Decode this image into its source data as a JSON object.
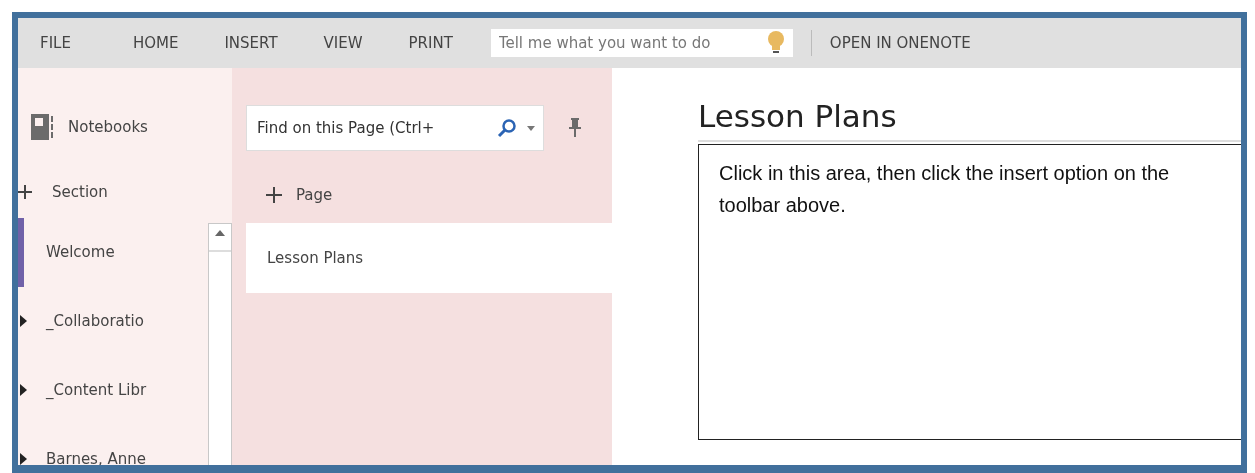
{
  "menu": [
    {
      "label": "FILE"
    },
    {
      "label": "HOME"
    },
    {
      "label": "INSERT"
    },
    {
      "label": "VIEW"
    },
    {
      "label": "PRINT"
    }
  ],
  "tell_me": {
    "placeholder": "Tell me what you want to do"
  },
  "open_button": "OPEN IN ONENOTE",
  "notebooks_label": "Notebooks",
  "add_section": "Section",
  "sections": [
    {
      "label": "Welcome",
      "selected": true,
      "expandable": false
    },
    {
      "label": "_Collaboratio",
      "selected": false,
      "expandable": true
    },
    {
      "label": "_Content Libr",
      "selected": false,
      "expandable": true
    },
    {
      "label": "Barnes, Anne",
      "selected": false,
      "expandable": true
    }
  ],
  "find": {
    "placeholder": "Find on this Page (Ctrl+"
  },
  "add_page": "Page",
  "pages": [
    {
      "label": "Lesson Plans",
      "selected": true
    }
  ],
  "page_title": "Lesson Plans",
  "note_text": "Click in this area, then click the insert option on the toolbar above."
}
